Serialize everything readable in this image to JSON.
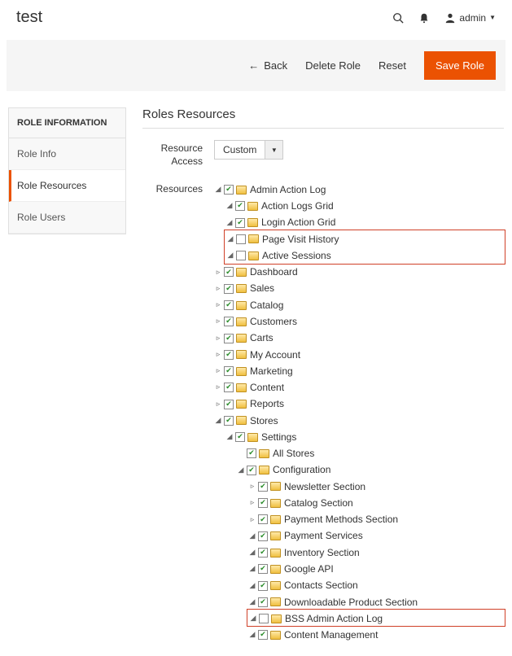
{
  "header": {
    "title": "test",
    "user_label": "admin"
  },
  "actions": {
    "back": "Back",
    "delete": "Delete Role",
    "reset": "Reset",
    "save": "Save Role"
  },
  "sidebar": {
    "title": "ROLE INFORMATION",
    "items": [
      {
        "label": "Role Info"
      },
      {
        "label": "Role Resources"
      },
      {
        "label": "Role Users"
      }
    ]
  },
  "main": {
    "heading": "Roles Resources",
    "access_label": "Resource Access",
    "access_value": "Custom",
    "resources_label": "Resources"
  },
  "tree": {
    "admin_action_log": "Admin Action Log",
    "action_logs_grid": "Action Logs Grid",
    "login_action_grid": "Login Action Grid",
    "page_visit_history": "Page Visit History",
    "active_sessions": "Active Sessions",
    "dashboard": "Dashboard",
    "sales": "Sales",
    "catalog": "Catalog",
    "customers": "Customers",
    "carts": "Carts",
    "my_account": "My Account",
    "marketing": "Marketing",
    "content": "Content",
    "reports": "Reports",
    "stores": "Stores",
    "settings": "Settings",
    "all_stores": "All Stores",
    "configuration": "Configuration",
    "newsletter_section": "Newsletter Section",
    "catalog_section": "Catalog Section",
    "payment_methods_section": "Payment Methods Section",
    "payment_services": "Payment Services",
    "inventory_section": "Inventory Section",
    "google_api": "Google API",
    "contacts_section": "Contacts Section",
    "downloadable_product_section": "Downloadable Product Section",
    "bss_admin_action_log": "BSS Admin Action Log",
    "content_management": "Content Management"
  }
}
